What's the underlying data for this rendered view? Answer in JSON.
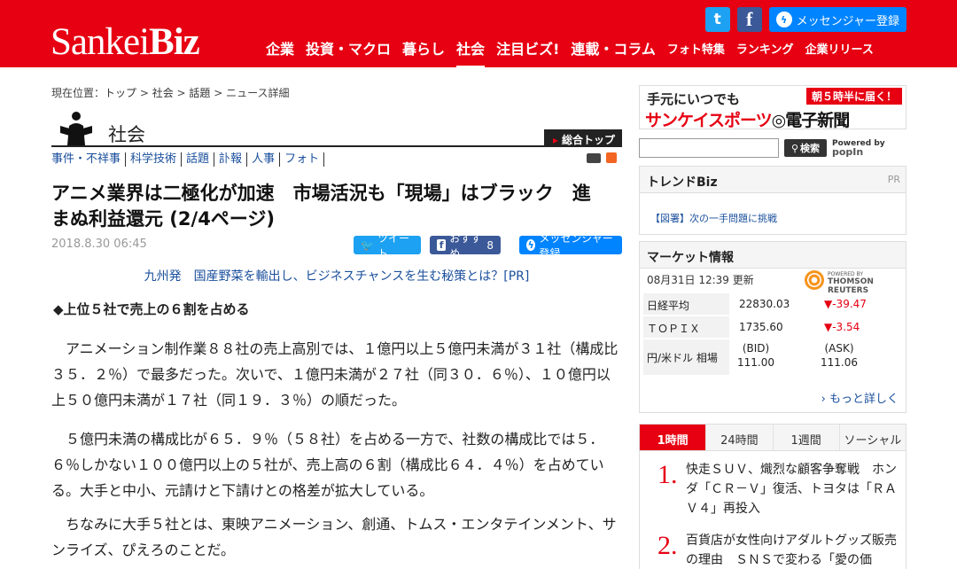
{
  "header": {
    "logo_main": "Sankei",
    "logo_bold": "Biz",
    "nav": [
      {
        "label": "企業"
      },
      {
        "label": "投資・マクロ"
      },
      {
        "label": "暮らし"
      },
      {
        "label": "社会"
      },
      {
        "label": "注目ビズ!"
      },
      {
        "label": "連載・コラム"
      },
      {
        "label": "フォト特集"
      },
      {
        "label": "ランキング"
      },
      {
        "label": "企業リリース"
      }
    ],
    "twitter_glyph": "t",
    "facebook_glyph": "f",
    "messenger_label": "メッセンジャー登録"
  },
  "breadcrumb": {
    "prefix": "現在位置：",
    "items": [
      "トップ",
      "社会",
      "話題",
      "ニュース詳細"
    ],
    "sep": " > "
  },
  "section": {
    "title": "社会",
    "top_link": "総合トップ",
    "subnav": [
      "事件・不祥事",
      "科学技術",
      "話題",
      "訃報",
      "人事",
      "フォト"
    ]
  },
  "article": {
    "title": "アニメ業界は二極化が加速　市場活況も「現場」はブラック　進まぬ利益還元 (2/4ページ)",
    "date": "2018.8.30 06:45",
    "tweet_label": "ツイート",
    "recommend_label": "おすすめ",
    "recommend_count": "8",
    "messenger_label": "メッセンジャー登録",
    "pr_link": "九州発　国産野菜を輸出し、ビジネスチャンスを生む秘策とは？[PR]",
    "subhead": "◆上位５社で売上の６割を占める",
    "paragraphs": [
      "アニメーション制作業８８社の売上高別では、１億円以上５億円未満が３１社（構成比３５．２％）で最多だった。次いで、１億円未満が２７社（同３０．６％）、１０億円以上５０億円未満が１７社（同１９．３％）の順だった。",
      "５億円未満の構成比が６５．９％（５８社）を占める一方で、社数の構成比では５．６％しかない１００億円以上の５社が、売上高の６割（構成比６４．４％）を占めている。大手と中小、元請けと下請けとの格差が拡大している。",
      "ちなみに大手５社とは、東映アニメーション、創通、トムス・エンタテインメント、サンライズ、ぴえろのことだ。"
    ]
  },
  "sidebar": {
    "ad_line1": "手元にいつでも",
    "ad_badge": "朝５時半に届く！",
    "ad_line2_red": "サンケイスポーツ",
    "ad_line2_black": "電子新聞",
    "search_button": "検索",
    "search_placeholder": "",
    "powered_by": "Powered by",
    "popin": "popIn",
    "trend": {
      "title": "トレンドBiz",
      "pr": "PR",
      "link": "【図署】次の一手問題に挑戦"
    },
    "market": {
      "title": "マーケット情報",
      "updated": "08月31日 12:39 更新",
      "provider_small": "POWERED BY",
      "provider": "THOMSON REUTERS",
      "rows": [
        {
          "label": "日経平均",
          "value": "22830.03",
          "change": "▼-39.47"
        },
        {
          "label": "ＴＯＰＩＸ",
          "value": "1735.60",
          "change": "▼-3.54"
        }
      ],
      "fx": {
        "label": "円/米ドル 相場",
        "bid_label": "(BID)",
        "bid": "111.00",
        "ask_label": "(ASK)",
        "ask": "111.06"
      },
      "more": "もっと詳しく"
    },
    "ranking": {
      "tabs": [
        "1時間",
        "24時間",
        "1週間",
        "ソーシャル"
      ],
      "items": [
        {
          "num": "1.",
          "text": "快走ＳＵＶ、熾烈な顧客争奪戦　ホンダ「ＣＲ－Ｖ」復活、トヨタは「ＲＡＶ４」再投入"
        },
        {
          "num": "2.",
          "text": "百貨店が女性向けアダルトグッズ販売の理由　ＳＮＳで変わる「愛の価"
        }
      ]
    }
  }
}
